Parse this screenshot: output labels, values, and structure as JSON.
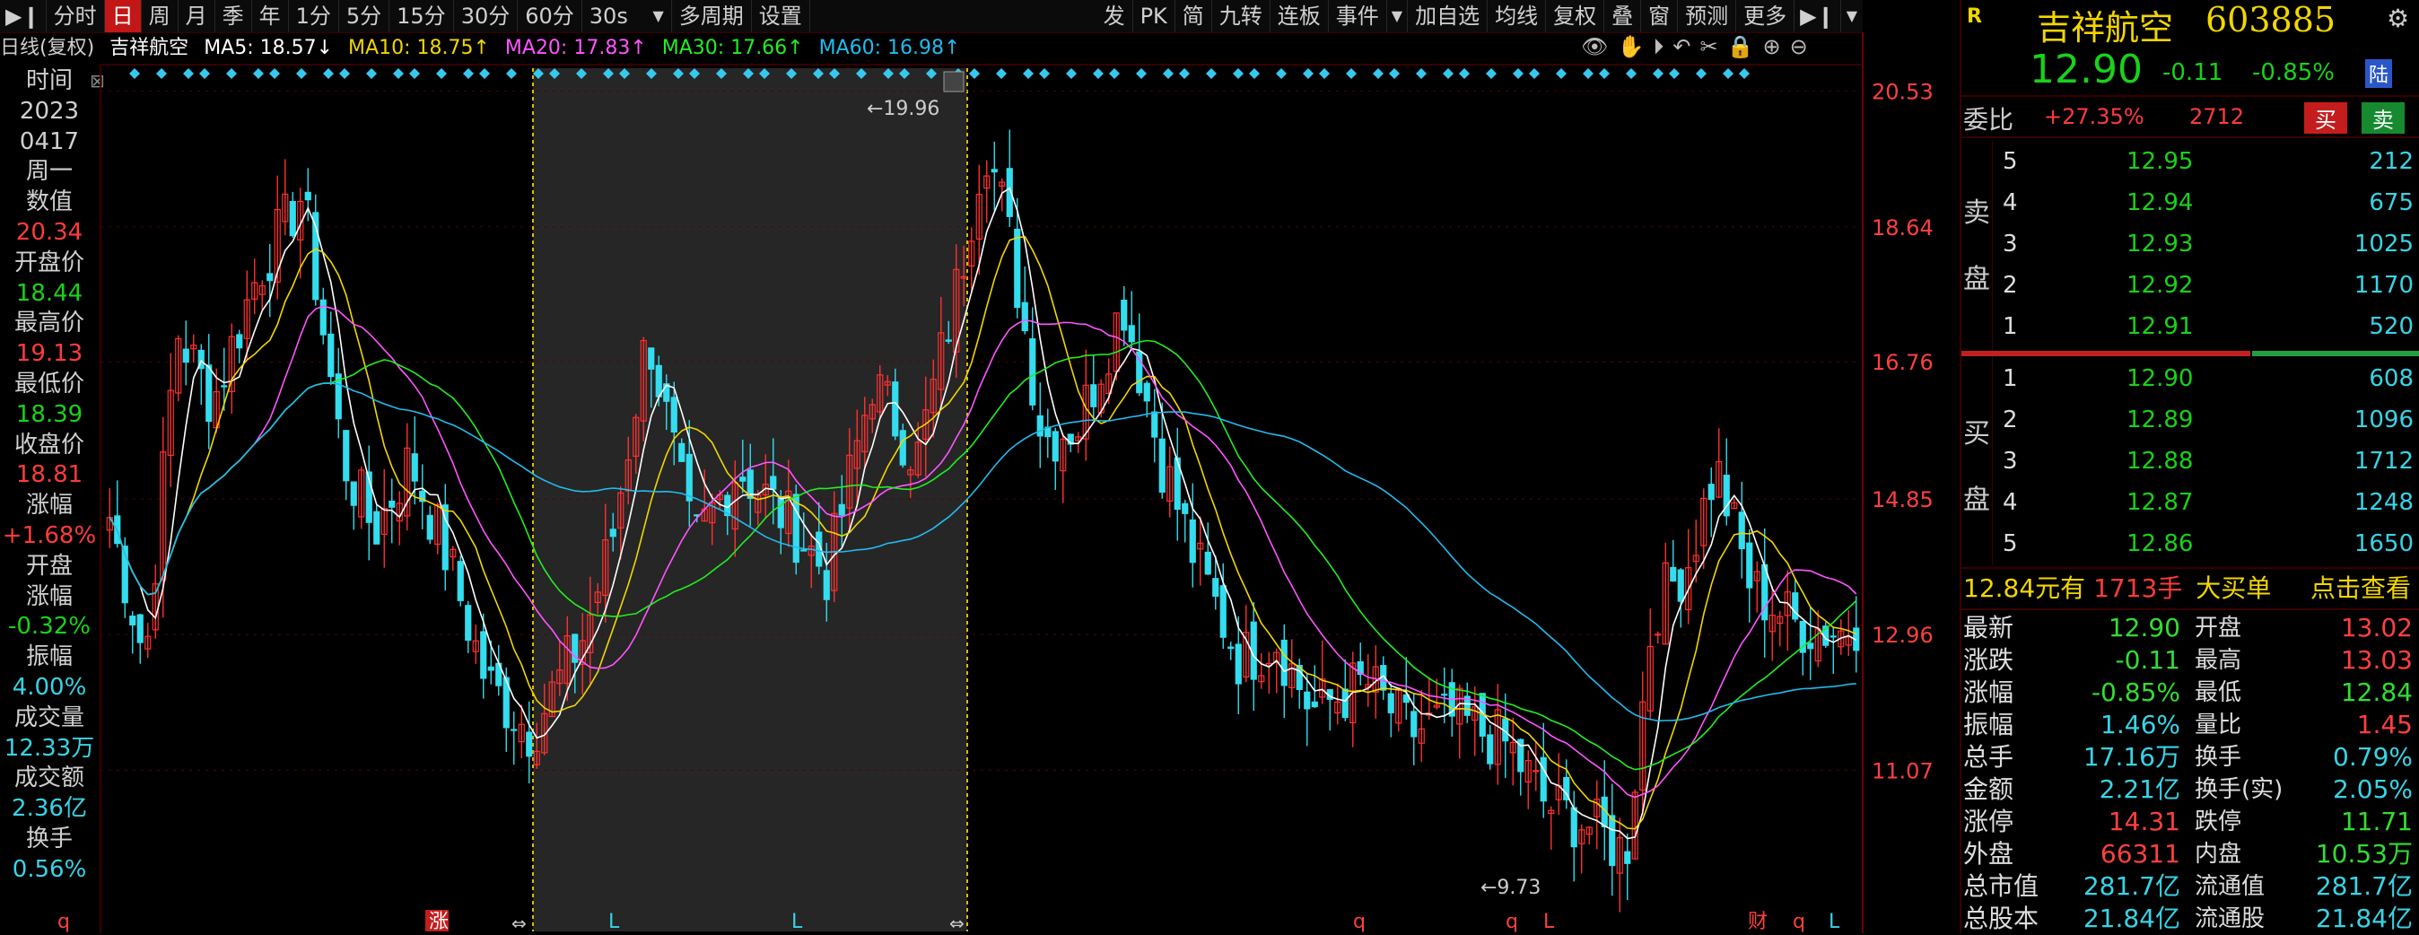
{
  "toolbar": {
    "items": [
      "分时",
      "日",
      "周",
      "月",
      "季",
      "年",
      "1分",
      "5分",
      "15分",
      "30分",
      "60分",
      "30s",
      "多周期",
      "设置"
    ],
    "active_index": 1,
    "right_items": [
      "发",
      "PK",
      "简",
      "九转",
      "连板",
      "事件",
      "加自选",
      "均线",
      "复权",
      "叠",
      "窗",
      "预测",
      "更多"
    ]
  },
  "infobar": {
    "period": "日线(复权)",
    "name": "吉祥航空",
    "ma5": "MA5: 18.57↓",
    "ma10": "MA10: 18.75↑",
    "ma20": "MA20: 17.83↑",
    "ma30": "MA30: 17.66↑",
    "ma60": "MA60: 16.98↑"
  },
  "leftcol": {
    "time_label": "时间",
    "year": "2023",
    "date": "0417",
    "weekday": "周一",
    "value_label": "数值",
    "value": "20.34",
    "open_label": "开盘价",
    "open": "18.44",
    "high_label": "最高价",
    "high": "19.13",
    "low_label": "最低价",
    "low": "18.39",
    "close_label": "收盘价",
    "close": "18.81",
    "chg_label": "涨幅",
    "chg": "+1.68%",
    "open_chg_label1": "开盘",
    "open_chg_label2": "涨幅",
    "open_chg": "-0.32%",
    "amp_label": "振幅",
    "amp": "4.00%",
    "vol_label": "成交量",
    "vol": "12.33万",
    "amt_label": "成交额",
    "amt": "2.36亿",
    "turn_label": "换手",
    "turn": "0.56%"
  },
  "chart_data": {
    "type": "candlestick",
    "title": "吉祥航空 日线(复权)",
    "y_ticks": [
      "20.53",
      "18.64",
      "16.76",
      "14.85",
      "12.96",
      "11.07"
    ],
    "ylim": [
      9.2,
      20.9
    ],
    "max_label": "19.96",
    "min_label": "9.73",
    "bottom_markers": [
      "q",
      "涨",
      "L",
      "L",
      "q",
      "q",
      "L",
      "财",
      "q",
      "L"
    ],
    "colors": {
      "up": "#ff3030",
      "down": "#33ddee",
      "ma5": "#ffffff",
      "ma10": "#f2d600",
      "ma20": "#ff55ff",
      "ma30": "#22ee22",
      "ma60": "#22bbee"
    }
  },
  "right": {
    "badge": "R",
    "name": "吉祥航空",
    "code": "603885",
    "price": "12.90",
    "change": "-0.11",
    "pct": "-0.85%",
    "market": "陆",
    "webi_label": "委比",
    "webi": "+27.35%",
    "weicha": "2712",
    "buy_btn": "买",
    "sell_btn": "卖",
    "sell_label": [
      "卖",
      "盘"
    ],
    "buy_label": [
      "买",
      "盘"
    ],
    "sells": [
      {
        "lvl": "5",
        "price": "12.95",
        "vol": "212"
      },
      {
        "lvl": "4",
        "price": "12.94",
        "vol": "675"
      },
      {
        "lvl": "3",
        "price": "12.93",
        "vol": "1025"
      },
      {
        "lvl": "2",
        "price": "12.92",
        "vol": "1170"
      },
      {
        "lvl": "1",
        "price": "12.91",
        "vol": "520"
      }
    ],
    "buys": [
      {
        "lvl": "1",
        "price": "12.90",
        "vol": "608"
      },
      {
        "lvl": "2",
        "price": "12.89",
        "vol": "1096"
      },
      {
        "lvl": "3",
        "price": "12.88",
        "vol": "1712"
      },
      {
        "lvl": "4",
        "price": "12.87",
        "vol": "1248"
      },
      {
        "lvl": "5",
        "price": "12.86",
        "vol": "1650"
      }
    ],
    "bigbuy_price": "12.84元有",
    "bigbuy_vol": "1713手",
    "bigbuy_text": "大买单",
    "bigbuy_link": "点击查看",
    "stats": [
      [
        "最新",
        "12.90",
        "开盘",
        "13.02"
      ],
      [
        "涨跌",
        "-0.11",
        "最高",
        "13.03"
      ],
      [
        "涨幅",
        "-0.85%",
        "最低",
        "12.84"
      ],
      [
        "振幅",
        "1.46%",
        "量比",
        "1.45"
      ],
      [
        "总手",
        "17.16万",
        "换手",
        "0.79%"
      ],
      [
        "金额",
        "2.21亿",
        "换手(实)",
        "2.05%"
      ],
      [
        "涨停",
        "14.31",
        "跌停",
        "11.71"
      ],
      [
        "外盘",
        "66311",
        "内盘",
        "10.53万"
      ],
      [
        "总市值",
        "281.7亿",
        "流通值",
        "281.7亿"
      ],
      [
        "总股本",
        "21.84亿",
        "流通股",
        "21.84亿"
      ]
    ],
    "stat_colors": [
      [
        "#33dd33",
        "#ff4040"
      ],
      [
        "#33dd33",
        "#ff4040"
      ],
      [
        "#33dd33",
        "#33dd33"
      ],
      [
        "#38d4e6",
        "#ff4040"
      ],
      [
        "#38d4e6",
        "#38d4e6"
      ],
      [
        "#38d4e6",
        "#38d4e6"
      ],
      [
        "#ff4040",
        "#33dd33"
      ],
      [
        "#ff4040",
        "#33dd33"
      ],
      [
        "#38d4e6",
        "#38d4e6"
      ],
      [
        "#38d4e6",
        "#38d4e6"
      ]
    ]
  }
}
